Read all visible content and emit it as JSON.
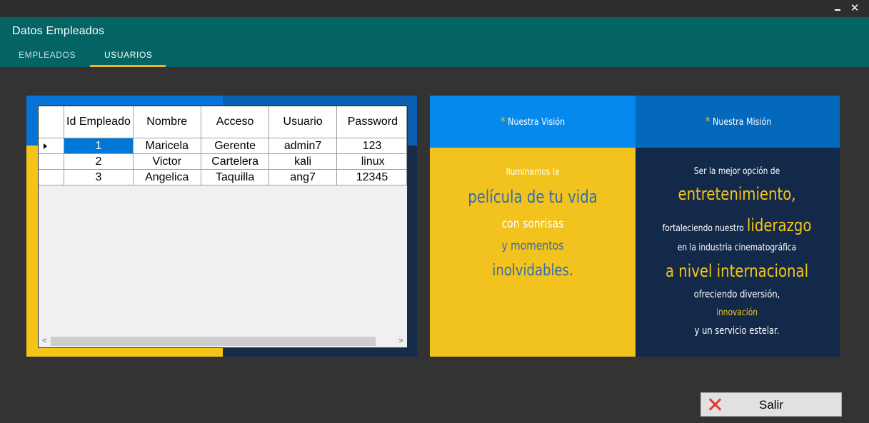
{
  "window": {
    "title": "Datos Empleados",
    "minimize_icon": "minimize-icon",
    "close_icon": "close-icon",
    "close_glyph": "✕"
  },
  "tabs": [
    {
      "label": "EMPLEADOS",
      "active": false
    },
    {
      "label": "USUARIOS",
      "active": true
    }
  ],
  "grid": {
    "columns": [
      "Id Empleado",
      "Nombre",
      "Acceso",
      "Usuario",
      "Password"
    ],
    "rows": [
      [
        "1",
        "Maricela",
        "Gerente",
        "admin7",
        "123"
      ],
      [
        "2",
        "Victor",
        "Cartelera",
        "kali",
        "linux"
      ],
      [
        "3",
        "Angelica",
        "Taquilla",
        "ang7",
        "12345"
      ]
    ],
    "selected_row": 0,
    "scroll_left_glyph": "<",
    "scroll_right_glyph": ">"
  },
  "banner": {
    "vision": {
      "header": "Nuestra Visión",
      "lines": [
        "Iluminamos la",
        "película de tu vida",
        "con sonrisas",
        "y momentos",
        "inolvidables."
      ]
    },
    "mision": {
      "header": "Nuestra Misión",
      "lines": [
        "Ser la mejor opción de",
        "entretenimiento,",
        "fortaleciendo nuestro",
        "liderazgo",
        "en la industria cinematográfica",
        "a nivel internacional",
        "ofreciendo diversión,",
        "innovación",
        "y un servicio estelar."
      ]
    },
    "star_glyph": "*"
  },
  "actions": {
    "exit_label": "Salir",
    "exit_icon": "red-x-icon"
  },
  "colors": {
    "header_teal": "#046464",
    "tab_accent": "#f5b31b",
    "selection_blue": "#0078d7",
    "exit_icon_red": "#e53935"
  }
}
